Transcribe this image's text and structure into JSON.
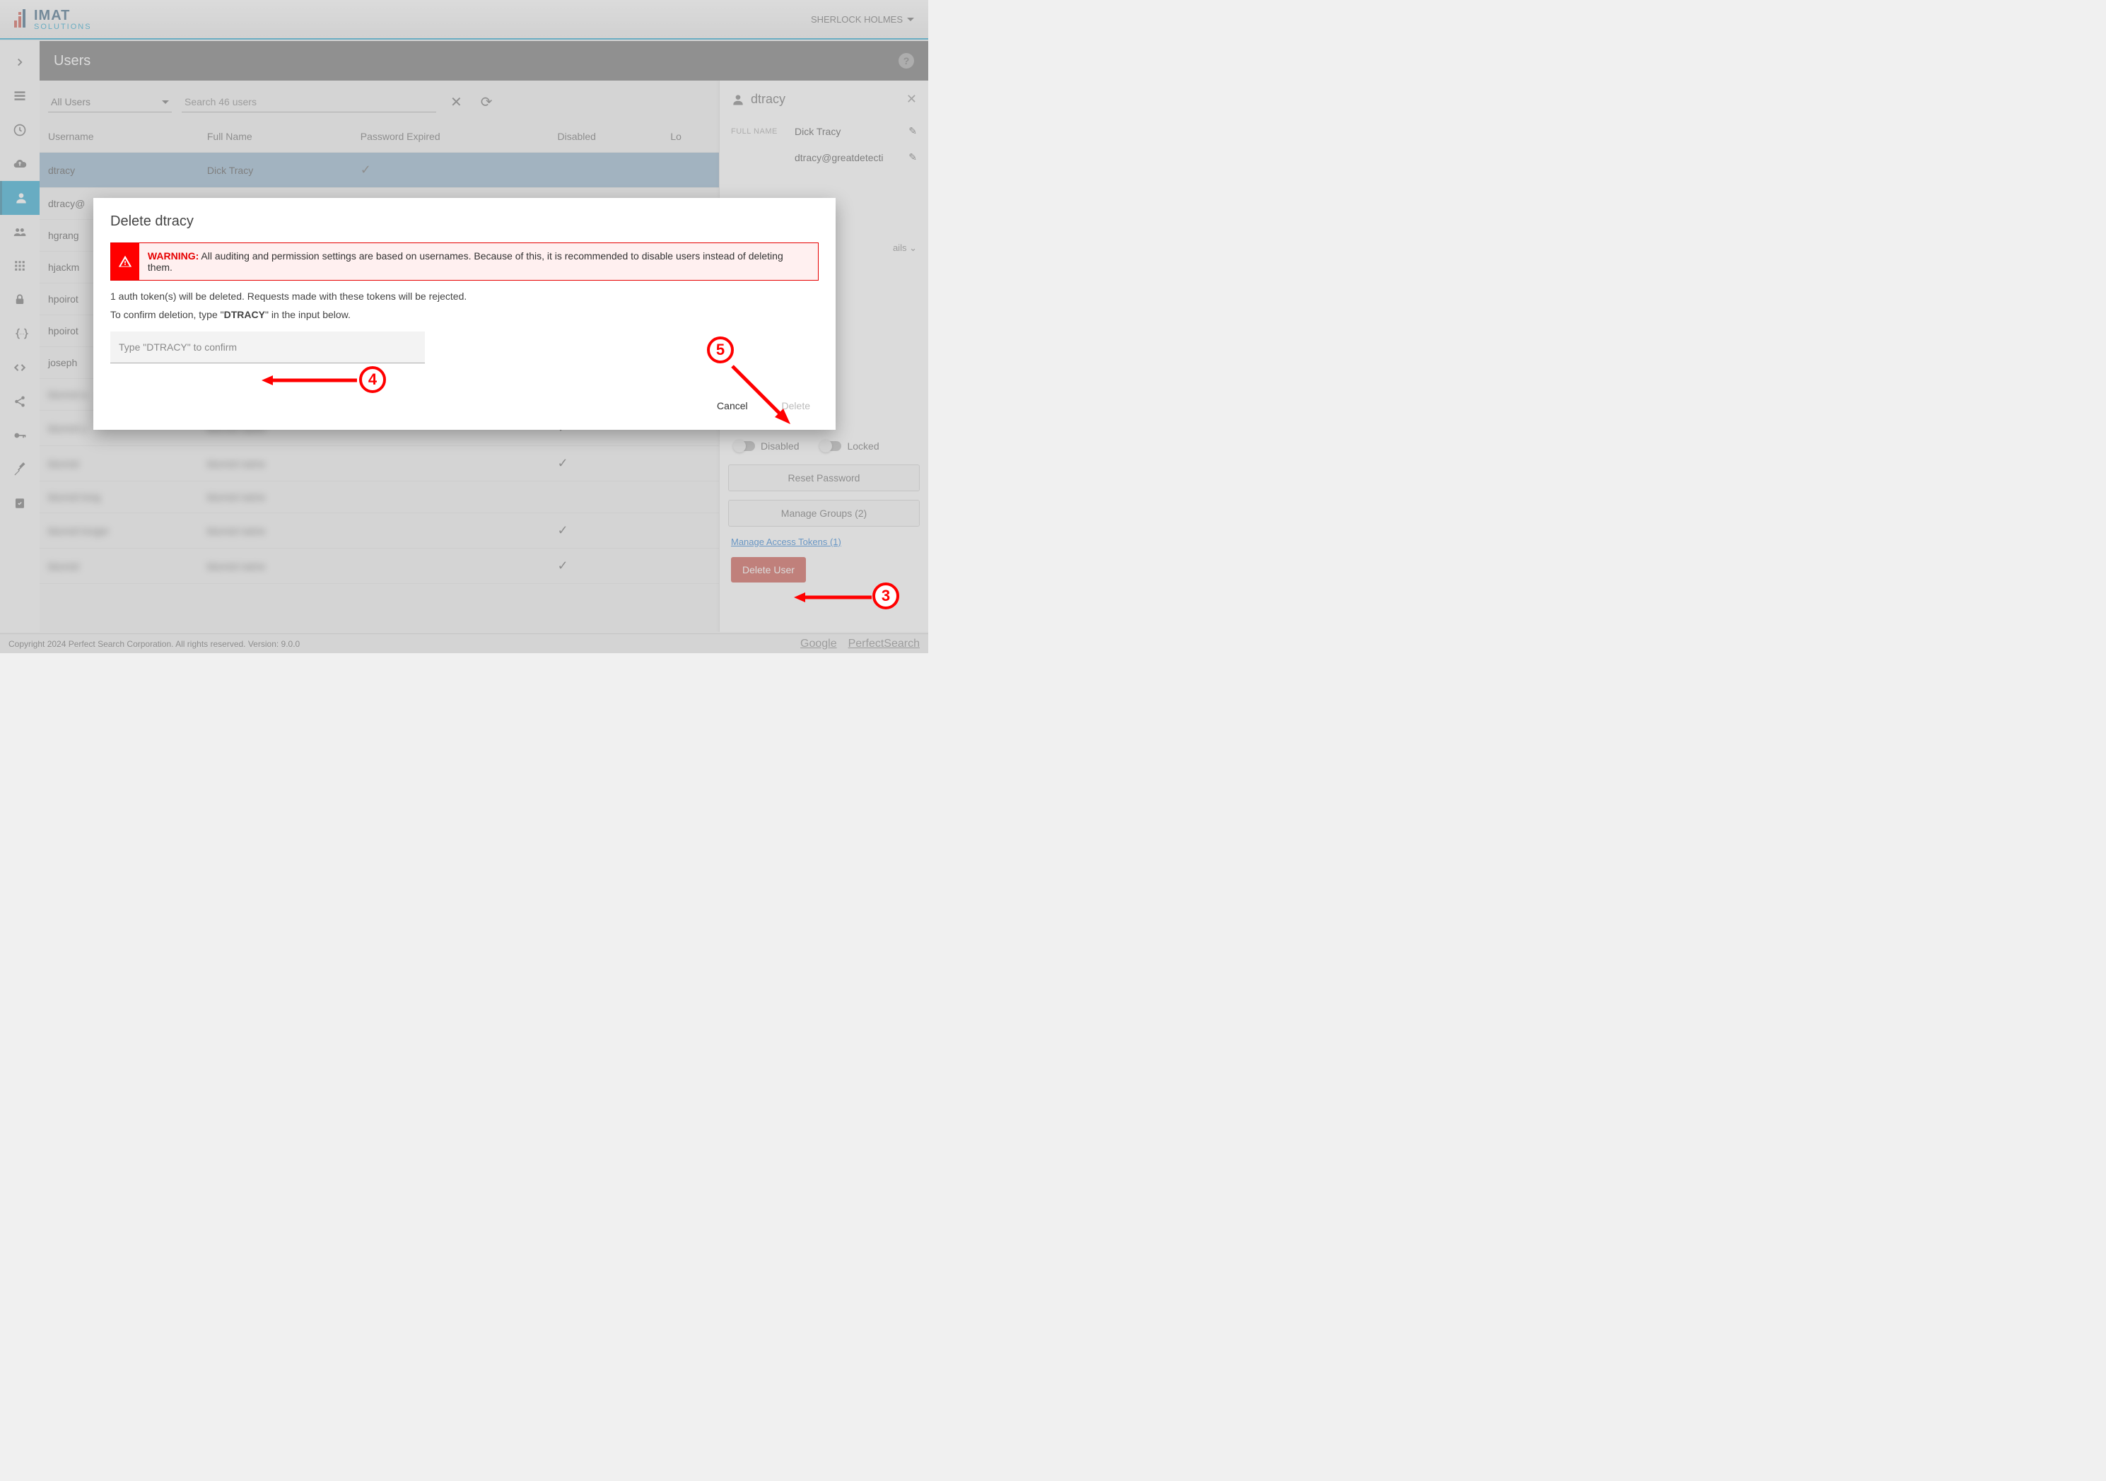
{
  "header": {
    "user_name": "SHERLOCK HOLMES"
  },
  "page": {
    "title": "Users"
  },
  "filter": {
    "select_label": "All Users",
    "search_placeholder": "Search 46 users"
  },
  "table": {
    "headers": {
      "username": "Username",
      "fullname": "Full Name",
      "pwexp": "Password Expired",
      "disabled": "Disabled",
      "locked": "Lo"
    },
    "rows": [
      {
        "username": "dtracy",
        "fullname": "Dick Tracy",
        "pwexp": true,
        "disabled": false,
        "selected": true,
        "blurred": false
      },
      {
        "username": "dtracy@",
        "fullname": "",
        "pwexp": false,
        "disabled": false,
        "blurred": false
      },
      {
        "username": "hgrang",
        "fullname": "",
        "pwexp": false,
        "disabled": false,
        "blurred": false
      },
      {
        "username": "hjackm",
        "fullname": "",
        "pwexp": false,
        "disabled": false,
        "blurred": false
      },
      {
        "username": "hpoirot",
        "fullname": "",
        "pwexp": false,
        "disabled": false,
        "blurred": false
      },
      {
        "username": "hpoirot",
        "fullname": "",
        "pwexp": false,
        "disabled": false,
        "blurred": false
      },
      {
        "username": "joseph",
        "fullname": "",
        "pwexp": false,
        "disabled": false,
        "blurred": false
      },
      {
        "username": "blurred a",
        "fullname": "",
        "pwexp": false,
        "disabled": false,
        "blurred": true
      },
      {
        "username": "blurred y",
        "fullname": "blurred name",
        "pwexp": false,
        "disabled": true,
        "blurred": true
      },
      {
        "username": "blurred",
        "fullname": "blurred name",
        "pwexp": false,
        "disabled": true,
        "blurred": true
      },
      {
        "username": "blurred long",
        "fullname": "blurred name",
        "pwexp": false,
        "disabled": false,
        "blurred": true
      },
      {
        "username": "blurred longer",
        "fullname": "blurred name",
        "pwexp": false,
        "disabled": true,
        "blurred": true
      },
      {
        "username": "blurred",
        "fullname": "blurred name",
        "pwexp": false,
        "disabled": true,
        "blurred": true
      }
    ]
  },
  "detail": {
    "username": "dtracy",
    "fullname_label": "FULL NAME",
    "fullname": "Dick Tracy",
    "email": "dtracy@greatdetecti",
    "expand": "ails",
    "toggle_disabled": "Disabled",
    "toggle_locked": "Locked",
    "reset_pw": "Reset Password",
    "manage_groups": "Manage Groups (2)",
    "manage_tokens": "Manage Access Tokens (1)",
    "delete_user": "Delete User"
  },
  "modal": {
    "title": "Delete dtracy",
    "warning_label": "WARNING:",
    "warning_text": "All auditing and permission settings are based on usernames. Because of this, it is recommended to disable users instead of deleting them.",
    "token_text": "1 auth token(s) will be deleted. Requests made with these tokens will be rejected.",
    "confirm_prefix": "To confirm deletion, type \"",
    "confirm_keyword": "DTRACY",
    "confirm_suffix": "\" in the input below.",
    "input_placeholder": "Type \"DTRACY\" to confirm",
    "cancel": "Cancel",
    "delete": "Delete"
  },
  "footer": {
    "copyright": "Copyright 2024 Perfect Search Corporation. All rights reserved. Version: 9.0.0",
    "link1": "Google",
    "link2": "PerfectSearch"
  },
  "annotations": {
    "a3": "3",
    "a4": "4",
    "a5": "5"
  }
}
